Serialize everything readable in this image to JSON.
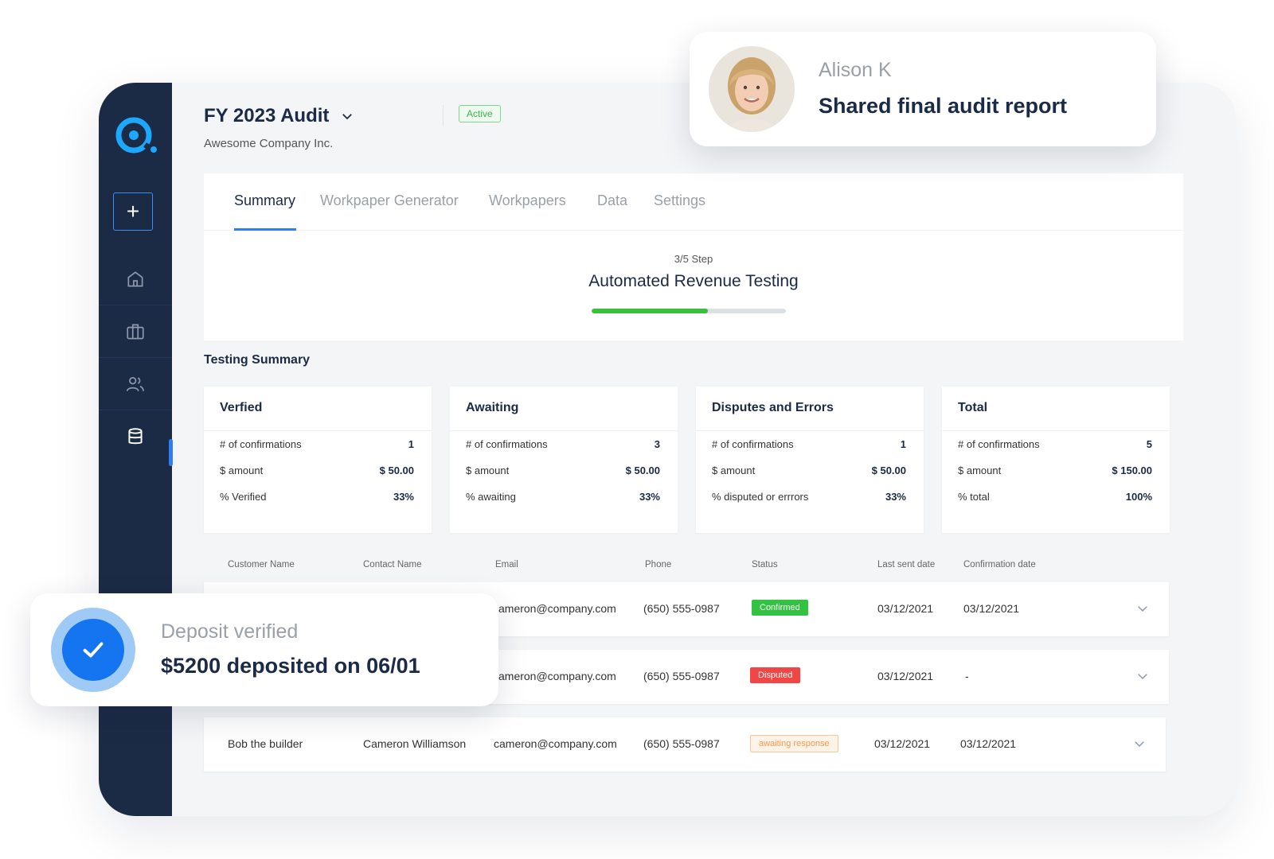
{
  "project": {
    "title": "FY 2023 Audit",
    "status": "Active",
    "company": "Awesome Company Inc."
  },
  "sidebar": {
    "add_label": "+",
    "items": [
      {
        "icon": "home-icon"
      },
      {
        "icon": "briefcase-icon"
      },
      {
        "icon": "users-icon"
      },
      {
        "icon": "database-icon",
        "active": true
      }
    ]
  },
  "tabs": [
    "Summary",
    "Workpaper Generator",
    "Workpapers",
    "Data",
    "Settings"
  ],
  "step": {
    "label": "3/5 Step",
    "title": "Automated Revenue Testing",
    "progress_fraction": 0.6
  },
  "testing_summary": {
    "title": "Testing Summary",
    "cards": [
      {
        "title": "Verfied",
        "rows": [
          {
            "label": "# of confirmations",
            "value": "1"
          },
          {
            "label": "$ amount",
            "value": "$ 50.00"
          },
          {
            "label": "% Verified",
            "value": "33%"
          }
        ]
      },
      {
        "title": "Awaiting",
        "rows": [
          {
            "label": "# of confirmations",
            "value": "3"
          },
          {
            "label": "$ amount",
            "value": "$ 50.00"
          },
          {
            "label": "% awaiting",
            "value": "33%"
          }
        ]
      },
      {
        "title": "Disputes and Errors",
        "rows": [
          {
            "label": "# of confirmations",
            "value": "1"
          },
          {
            "label": "$ amount",
            "value": "$ 50.00"
          },
          {
            "label": "%  disputed or errrors",
            "value": "33%"
          }
        ]
      },
      {
        "title": "Total",
        "rows": [
          {
            "label": "# of confirmations",
            "value": "5"
          },
          {
            "label": "$ amount",
            "value": "$ 150.00"
          },
          {
            "label": "% total",
            "value": "100%"
          }
        ]
      }
    ]
  },
  "table": {
    "columns": [
      "Customer Name",
      "Contact Name",
      "Email",
      "Phone",
      "Status",
      "Last sent date",
      "Confirmation date"
    ],
    "rows": [
      {
        "customer": "",
        "contact": "",
        "email": "cameron@company.com",
        "email_visible": "ameron@company.com",
        "phone": "(650) 555-0987",
        "status": "Confirmed",
        "last_sent": "03/12/2021",
        "confirmation": "03/12/2021"
      },
      {
        "customer": "",
        "contact": "",
        "email": "cameron@company.com",
        "email_visible": "ameron@company.com",
        "phone": "(650) 555-0987",
        "status": "Disputed",
        "last_sent": "03/12/2021",
        "confirmation": "-"
      },
      {
        "customer": "Bob the builder",
        "contact": "Cameron Williamson",
        "email": "cameron@company.com",
        "email_visible": "cameron@company.com",
        "phone": "(650) 555-0987",
        "status": "awaiting response",
        "last_sent": "03/12/2021",
        "confirmation": "03/12/2021"
      }
    ]
  },
  "notifications": {
    "top": {
      "name": "Alison K",
      "message": "Shared final audit report"
    },
    "bottom": {
      "title": "Deposit verified",
      "message": "$5200 deposited on 06/01"
    }
  },
  "colors": {
    "sidebar": "#1b2a45",
    "accent": "#2f7df6",
    "progress": "#3cbf3c",
    "confirmed": "#34c243",
    "disputed": "#f24545",
    "awaiting": "#f39a53"
  }
}
